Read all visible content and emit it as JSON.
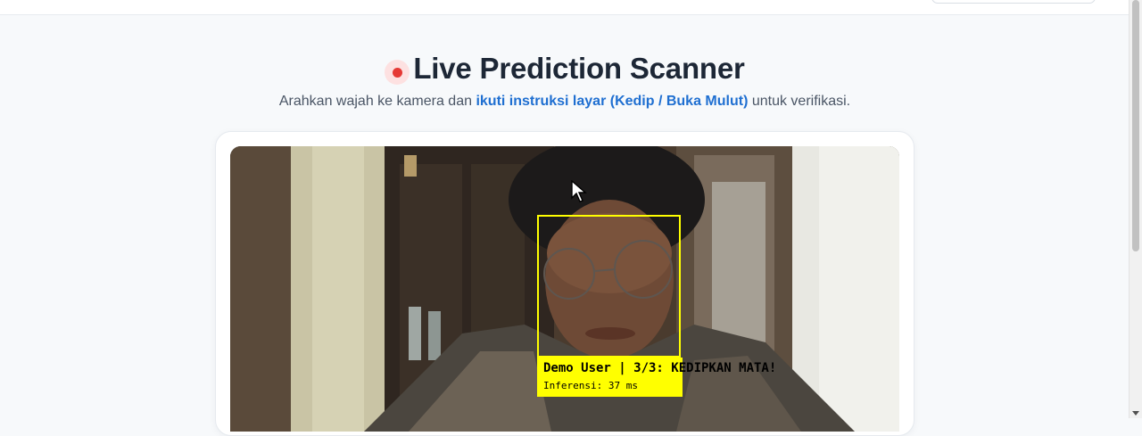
{
  "header": {
    "title": "Live Prediction Scanner",
    "subtitle_start": "Arahkan wajah ke kamera dan ",
    "subtitle_highlight": "ikuti instruksi layar (Kedip / Buka Mulut)",
    "subtitle_end": " untuk verifikasi."
  },
  "scanner": {
    "overlay_label": "Demo User | 3/3: KEDIPKAN MATA!",
    "inference_label": "Inferensi: 37 ms"
  },
  "colors": {
    "accent": "#1f6fd1",
    "record": "#e53935",
    "face_box": "#ffff00"
  }
}
